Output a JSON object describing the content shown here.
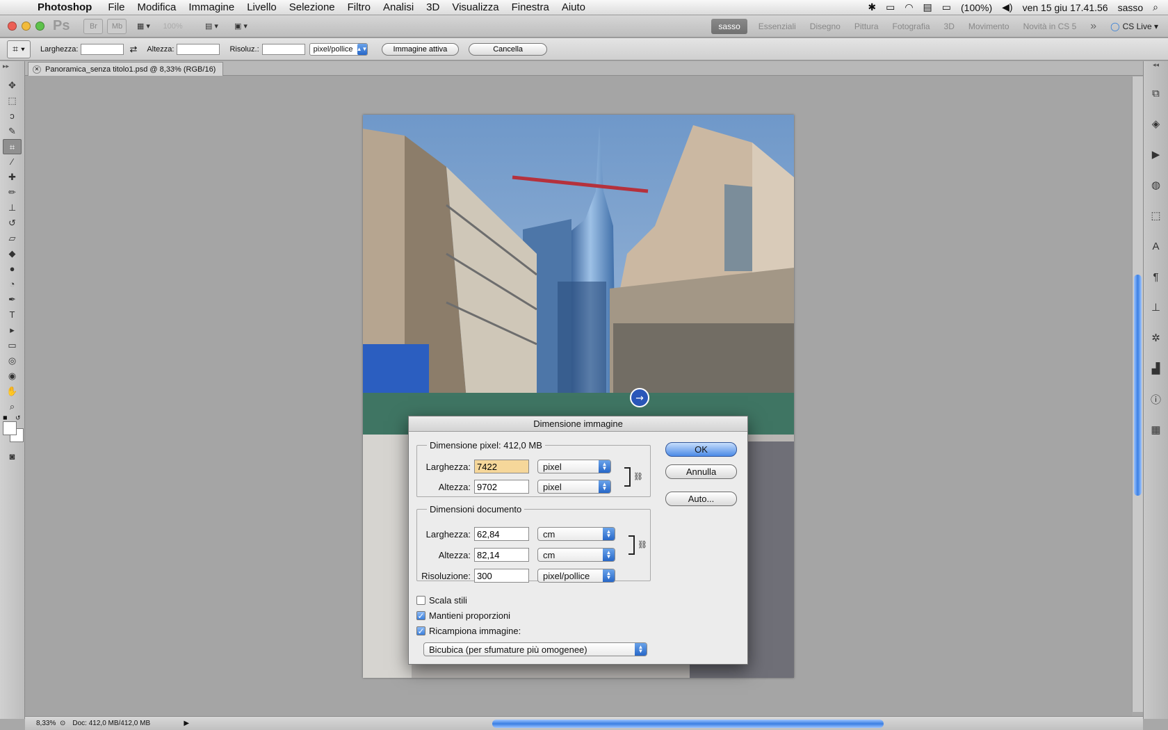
{
  "menubar": {
    "apple_icon": "apple-icon",
    "app_name": "Photoshop",
    "items": [
      "File",
      "Modifica",
      "Immagine",
      "Livello",
      "Selezione",
      "Filtro",
      "Analisi",
      "3D",
      "Visualizza",
      "Finestra",
      "Aiuto"
    ],
    "battery": "(100%)",
    "datetime": "ven 15 giu  17.41.56",
    "user": "sasso"
  },
  "appbar": {
    "ps_logo": "Ps",
    "br_logo": "Br",
    "mb_logo": "Mb",
    "zoom_value": "100%",
    "workspaces": [
      "sasso",
      "Essenziali",
      "Disegno",
      "Pittura",
      "Fotografia",
      "3D",
      "Movimento",
      "Novità in CS 5"
    ],
    "more": "»",
    "cs_live": "CS Live"
  },
  "options": {
    "width_label": "Larghezza:",
    "height_label": "Altezza:",
    "res_label": "Risoluz.:",
    "res_unit": "pixel/pollice",
    "front_image": "Immagine attiva",
    "clear": "Cancella"
  },
  "document": {
    "tab_title": "Panoramica_senza titolo1.psd @ 8,33% (RGB/16)"
  },
  "status": {
    "zoom": "8,33%",
    "doc_size": "Doc: 412,0 MB/412,0 MB"
  },
  "dialog": {
    "title": "Dimensione immagine",
    "pixel_group": "Dimensione pixel:",
    "pixel_size": "412,0 MB",
    "px_width_label": "Larghezza:",
    "px_width_value": "7422",
    "px_width_unit": "pixel",
    "px_height_label": "Altezza:",
    "px_height_value": "9702",
    "px_height_unit": "pixel",
    "doc_group": "Dimensioni documento",
    "doc_width_label": "Larghezza:",
    "doc_width_value": "62,84",
    "doc_width_unit": "cm",
    "doc_height_label": "Altezza:",
    "doc_height_value": "82,14",
    "doc_height_unit": "cm",
    "res_label": "Risoluzione:",
    "res_value": "300",
    "res_unit": "pixel/pollice",
    "scale_styles": "Scala stili",
    "constrain": "Mantieni proporzioni",
    "resample": "Ricampiona immagine:",
    "resample_method": "Bicubica (per sfumature più omogenee)",
    "ok": "OK",
    "cancel": "Annulla",
    "auto": "Auto...",
    "scale_styles_checked": false,
    "constrain_checked": true,
    "resample_checked": true
  },
  "colors": {
    "accent": "#3b7fe3",
    "highlight": "#f6d79a"
  }
}
